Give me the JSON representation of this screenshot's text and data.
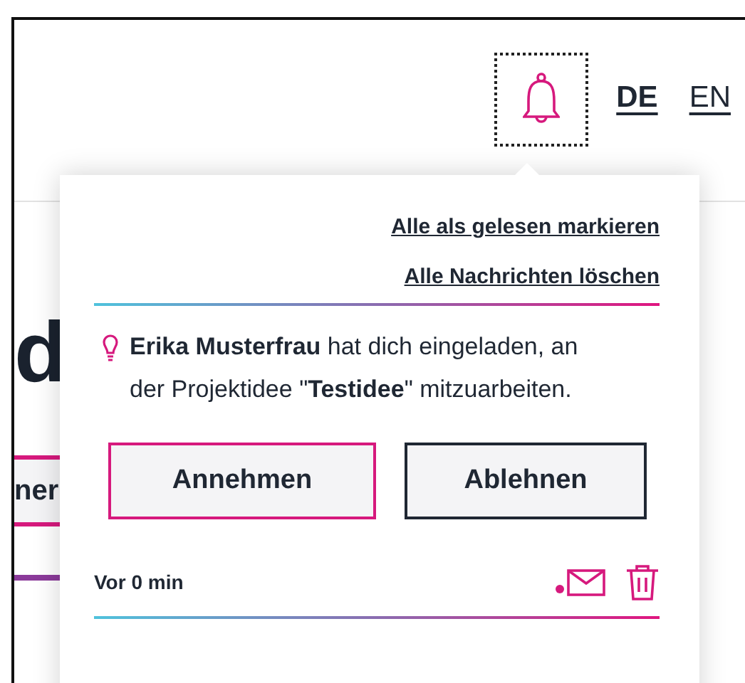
{
  "header": {
    "notification_button": {
      "focused": true
    },
    "languages": [
      {
        "label": "DE",
        "selected": true
      },
      {
        "label": "EN",
        "selected": false
      }
    ]
  },
  "background_page": {
    "heading_fragment": "d",
    "button_fragment": "ner"
  },
  "notification_popup": {
    "actions": [
      "Alle als gelesen markieren",
      "Alle Nachrichten löschen"
    ],
    "notification": {
      "message": "**Erika Musterfrau** hat dich eingeladen, an der Projektidee \"**Testidee**\" mitzuarbeiten.",
      "buttons": [
        {
          "label": "Annehmen",
          "kind": "primary"
        },
        {
          "label": "Ablehnen",
          "kind": "secondary"
        }
      ],
      "time": "Vor 0 min",
      "unread": true
    }
  }
}
